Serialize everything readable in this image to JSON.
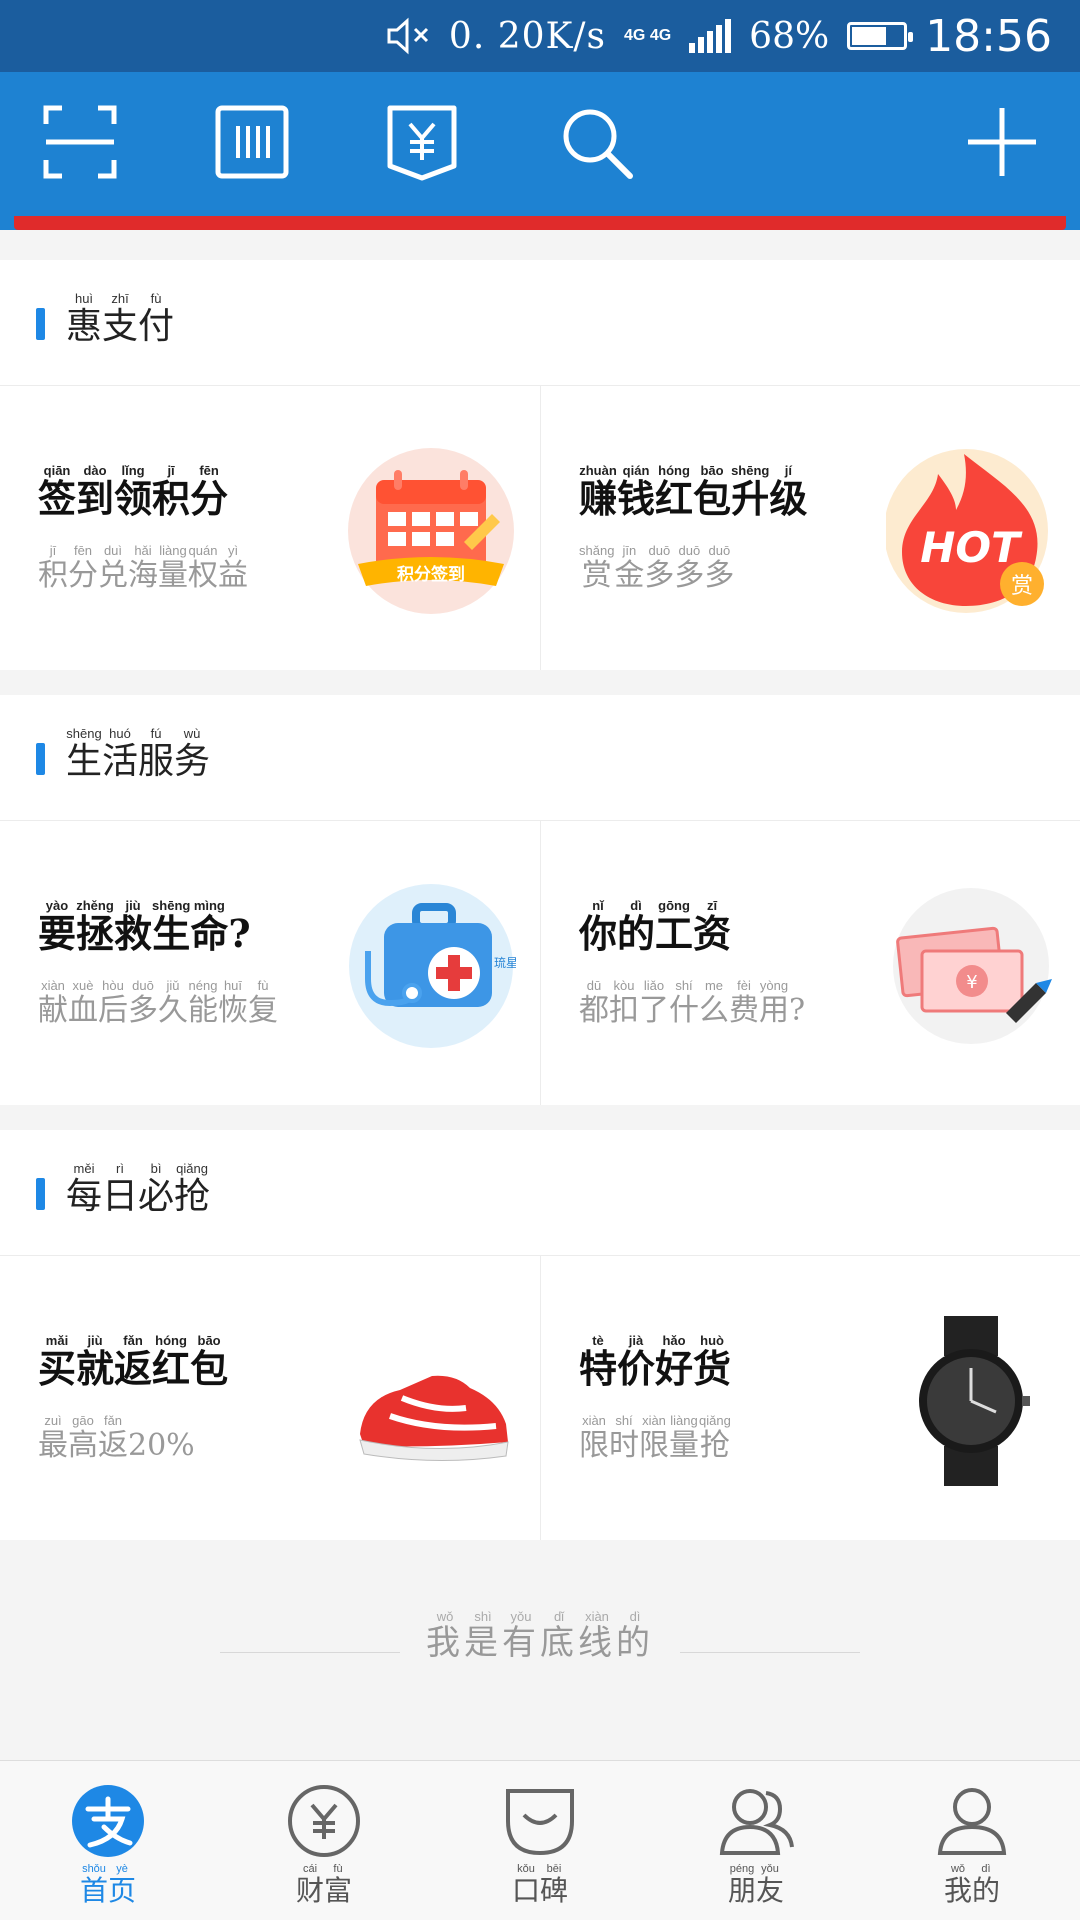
{
  "status_bar": {
    "net_speed": "0. 20K/s",
    "network_type": "4G 4G",
    "battery_percent": "68%",
    "battery_level": 0.68,
    "time": "18:56"
  },
  "toolbar": {
    "icons": [
      "scan-icon",
      "barcode-pay-icon",
      "bill-icon",
      "search-icon",
      "plus-icon"
    ]
  },
  "sections": [
    {
      "title": [
        {
          "c": "惠",
          "p": "huì"
        },
        {
          "c": "支",
          "p": "zhī"
        },
        {
          "c": "付",
          "p": "fù"
        }
      ],
      "cards": [
        {
          "title": [
            {
              "c": "签",
              "p": "qiān"
            },
            {
              "c": "到",
              "p": "dào"
            },
            {
              "c": "领",
              "p": "lǐng"
            },
            {
              "c": "积",
              "p": "jī"
            },
            {
              "c": "分",
              "p": "fēn"
            }
          ],
          "subtitle": [
            {
              "c": "积",
              "p": "jī"
            },
            {
              "c": "分",
              "p": "fēn"
            },
            {
              "c": "兑",
              "p": "duì"
            },
            {
              "c": "海",
              "p": "hǎi"
            },
            {
              "c": "量",
              "p": "liàng"
            },
            {
              "c": "权",
              "p": "quán"
            },
            {
              "c": "益",
              "p": "yì"
            }
          ],
          "image": "calendar-checkin-image",
          "badge": "积分签到"
        },
        {
          "title": [
            {
              "c": "赚",
              "p": "zhuàn"
            },
            {
              "c": "钱",
              "p": "qián"
            },
            {
              "c": "红",
              "p": "hóng"
            },
            {
              "c": "包",
              "p": "bāo"
            },
            {
              "c": "升",
              "p": "shēng"
            },
            {
              "c": "级",
              "p": "jí"
            }
          ],
          "subtitle": [
            {
              "c": "赏",
              "p": "shǎng"
            },
            {
              "c": "金",
              "p": "jīn"
            },
            {
              "c": "多",
              "p": "duō"
            },
            {
              "c": "多",
              "p": "duō"
            },
            {
              "c": "多",
              "p": "duō"
            }
          ],
          "image": "hot-flame-image",
          "badge": "HOT",
          "badge2": "赏"
        }
      ]
    },
    {
      "title": [
        {
          "c": "生",
          "p": "shēng"
        },
        {
          "c": "活",
          "p": "huó"
        },
        {
          "c": "服",
          "p": "fú"
        },
        {
          "c": "务",
          "p": "wù"
        }
      ],
      "cards": [
        {
          "title": [
            {
              "c": "要",
              "p": "yào"
            },
            {
              "c": "拯",
              "p": "zhěng"
            },
            {
              "c": "救",
              "p": "jiù"
            },
            {
              "c": "生",
              "p": "shēng"
            },
            {
              "c": "命",
              "p": "mìng"
            },
            {
              "c": "?",
              "p": ""
            }
          ],
          "subtitle": [
            {
              "c": "献",
              "p": "xiàn"
            },
            {
              "c": "血",
              "p": "xuè"
            },
            {
              "c": "后",
              "p": "hòu"
            },
            {
              "c": "多",
              "p": "duō"
            },
            {
              "c": "久",
              "p": "jiǔ"
            },
            {
              "c": "能",
              "p": "néng"
            },
            {
              "c": "恢",
              "p": "huī"
            },
            {
              "c": "复",
              "p": "fù"
            }
          ],
          "image": "medical-kit-image",
          "overlay_text": "琉星社区"
        },
        {
          "title": [
            {
              "c": "你",
              "p": "nǐ"
            },
            {
              "c": "的",
              "p": "dì"
            },
            {
              "c": "工",
              "p": "gōng"
            },
            {
              "c": "资",
              "p": "zī"
            }
          ],
          "subtitle": [
            {
              "c": "都",
              "p": "dū"
            },
            {
              "c": "扣",
              "p": "kòu"
            },
            {
              "c": "了",
              "p": "liǎo"
            },
            {
              "c": "什",
              "p": "shí"
            },
            {
              "c": "么",
              "p": "me"
            },
            {
              "c": "费",
              "p": "fèi"
            },
            {
              "c": "用",
              "p": "yòng"
            },
            {
              "c": "?",
              "p": ""
            }
          ],
          "image": "money-bills-image"
        }
      ]
    },
    {
      "title": [
        {
          "c": "每",
          "p": "měi"
        },
        {
          "c": "日",
          "p": "rì"
        },
        {
          "c": "必",
          "p": "bì"
        },
        {
          "c": "抢",
          "p": "qiǎng"
        }
      ],
      "cards": [
        {
          "title": [
            {
              "c": "买",
              "p": "mǎi"
            },
            {
              "c": "就",
              "p": "jiù"
            },
            {
              "c": "返",
              "p": "fǎn"
            },
            {
              "c": "红",
              "p": "hóng"
            },
            {
              "c": "包",
              "p": "bāo"
            }
          ],
          "subtitle": [
            {
              "c": "最",
              "p": "zuì"
            },
            {
              "c": "高",
              "p": "gāo"
            },
            {
              "c": "返",
              "p": "fǎn"
            },
            {
              "c": "20%",
              "p": ""
            }
          ],
          "image": "red-sneaker-image"
        },
        {
          "title": [
            {
              "c": "特",
              "p": "tè"
            },
            {
              "c": "价",
              "p": "jià"
            },
            {
              "c": "好",
              "p": "hǎo"
            },
            {
              "c": "货",
              "p": "huò"
            }
          ],
          "subtitle": [
            {
              "c": "限",
              "p": "xiàn"
            },
            {
              "c": "时",
              "p": "shí"
            },
            {
              "c": "限",
              "p": "xiàn"
            },
            {
              "c": "量",
              "p": "liàng"
            },
            {
              "c": "抢",
              "p": "qiǎng"
            }
          ],
          "image": "wrist-watch-image"
        }
      ]
    }
  ],
  "slogan": [
    {
      "c": "我",
      "p": "wǒ"
    },
    {
      "c": "是",
      "p": "shì"
    },
    {
      "c": "有",
      "p": "yǒu"
    },
    {
      "c": "底",
      "p": "dǐ"
    },
    {
      "c": "线",
      "p": "xiàn"
    },
    {
      "c": "的",
      "p": "dì"
    }
  ],
  "bottom_nav": [
    {
      "label": [
        {
          "c": "首",
          "p": "shǒu"
        },
        {
          "c": "页",
          "p": "yè"
        }
      ],
      "icon": "alipay-home-icon",
      "active": true
    },
    {
      "label": [
        {
          "c": "财",
          "p": "cái"
        },
        {
          "c": "富",
          "p": "fù"
        }
      ],
      "icon": "wealth-yen-icon",
      "active": false
    },
    {
      "label": [
        {
          "c": "口",
          "p": "kǒu"
        },
        {
          "c": "碑",
          "p": "bēi"
        }
      ],
      "icon": "koubei-icon",
      "active": false
    },
    {
      "label": [
        {
          "c": "朋",
          "p": "péng"
        },
        {
          "c": "友",
          "p": "yǒu"
        }
      ],
      "icon": "friends-icon",
      "active": false
    },
    {
      "label": [
        {
          "c": "我",
          "p": "wǒ"
        },
        {
          "c": "的",
          "p": "dì"
        }
      ],
      "icon": "profile-icon",
      "active": false
    }
  ],
  "colors": {
    "status_bar": "#1b5d9e",
    "toolbar": "#1e82d2",
    "accent": "#1e88e5",
    "red_strip": "#e02b2b"
  }
}
